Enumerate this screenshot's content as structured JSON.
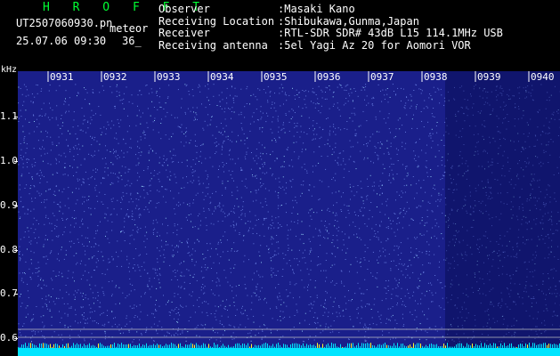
{
  "header": {
    "brand": "H R O F F T",
    "file_name": "UT2507060930.pn",
    "meteor_label": "meteor",
    "datetime": "25.07.06 09:30",
    "meteor_count": "36_"
  },
  "info": [
    {
      "key": "Observer",
      "value": ":Masaki Kano"
    },
    {
      "key": "Receiving Location",
      "value": ":Shibukawa,Gunma,Japan"
    },
    {
      "key": "Receiver",
      "value": ":RTL-SDR SDR# 43dB L15 114.1MHz USB"
    },
    {
      "key": "Receiving antenna",
      "value": ":5el Yagi Az 20 for Aomori VOR"
    }
  ],
  "chart_data": {
    "type": "heatmap",
    "ylabel": "kHz",
    "y_ticks": [
      "1.1",
      "1.0",
      "0.9",
      "0.8",
      "0.7",
      "0.6"
    ],
    "time_labels": [
      "0931",
      "0932",
      "0933",
      "0934",
      "0935",
      "0936",
      "0937",
      "0938",
      "0939",
      "0940"
    ],
    "colors": {
      "background": "#1a1f8a",
      "noise_light": "#6f86e8",
      "noise_bright": "#9fe0ff",
      "baseline": "#00e5ff",
      "grid_line": "#c8c8c8"
    }
  }
}
